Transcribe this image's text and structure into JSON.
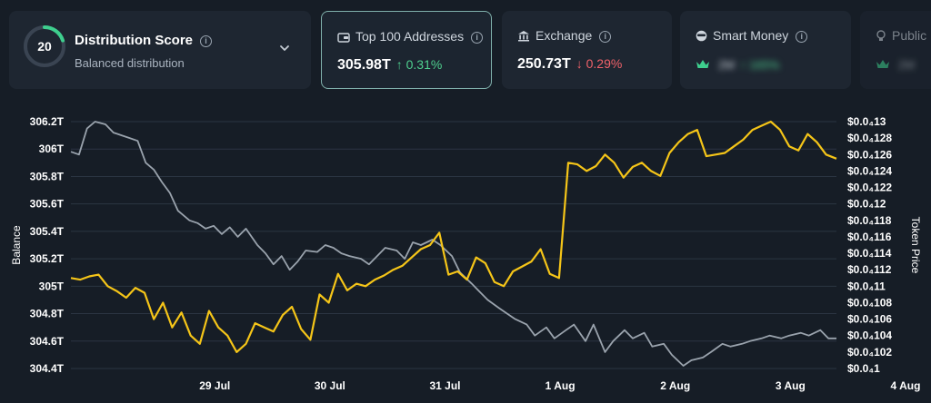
{
  "cards": {
    "distribution": {
      "score": "20",
      "title": "Distribution Score",
      "subtitle": "Balanced distribution",
      "info": "i",
      "gauge_fraction": 0.2,
      "gauge_color": "#3ecf8e"
    },
    "top100": {
      "label": "Top 100 Addresses",
      "value": "305.98T",
      "change": "↑ 0.31%",
      "info": "i"
    },
    "exchange": {
      "label": "Exchange",
      "value": "250.73T",
      "change": "↓ 0.29%",
      "info": "i"
    },
    "smart_money": {
      "label": "Smart Money",
      "value": "2M",
      "change": "↑ 165%",
      "info": "i"
    },
    "public": {
      "label": "Public",
      "value": "2M"
    }
  },
  "colors": {
    "balance_line": "#9aa3ad",
    "price_line": "#f5c518",
    "grid": "#2b3542",
    "positive": "#4fd08f",
    "negative": "#f0626a",
    "crown": "#3ecf8e"
  },
  "chart_data": {
    "type": "line",
    "ylabel": "Balance",
    "y2label": "Token Price",
    "x_ticks": [
      "29 Jul",
      "30 Jul",
      "31 Jul",
      "1 Aug",
      "2 Aug",
      "3 Aug",
      "4 Aug"
    ],
    "x_range": [
      27.75,
      34.4
    ],
    "ylim": [
      304.4,
      306.2
    ],
    "y_ticks": [
      "304.4T",
      "304.6T",
      "304.8T",
      "305T",
      "305.2T",
      "305.4T",
      "305.6T",
      "305.8T",
      "306T",
      "306.2T"
    ],
    "y2lim": [
      0.0001,
      0.00013
    ],
    "y2_ticks": [
      "$0.0₄1",
      "$0.0₄102",
      "$0.0₄104",
      "$0.0₄106",
      "$0.0₄108",
      "$0.0₄11",
      "$0.0₄112",
      "$0.0₄114",
      "$0.0₄116",
      "$0.0₄118",
      "$0.0₄12",
      "$0.0₄122",
      "$0.0₄124",
      "$0.0₄126",
      "$0.0₄128",
      "$0.0₄13"
    ],
    "grid": true,
    "series": [
      {
        "name": "Balance",
        "axis": "left",
        "x": [
          27.75,
          27.82,
          27.89,
          27.96,
          28.05,
          28.12,
          28.19,
          28.26,
          28.33,
          28.4,
          28.47,
          28.54,
          28.61,
          28.68,
          28.78,
          28.85,
          28.92,
          28.99,
          29.06,
          29.13,
          29.2,
          29.27,
          29.37,
          29.44,
          29.51,
          29.58,
          29.65,
          29.72,
          29.79,
          29.89,
          29.96,
          30.03,
          30.1,
          30.17,
          30.27,
          30.34,
          30.41,
          30.48,
          30.58,
          30.65,
          30.72,
          30.79,
          30.89,
          30.96,
          31.06,
          31.13,
          31.23,
          31.3,
          31.37,
          31.47,
          31.54,
          31.61,
          31.71,
          31.78,
          31.88,
          31.95,
          32.05,
          32.12,
          32.22,
          32.29,
          32.39,
          32.46,
          32.56,
          32.63,
          32.73,
          32.8,
          32.9,
          32.97,
          33.07,
          33.14,
          33.24,
          33.31,
          33.41,
          33.48,
          33.58,
          33.65,
          33.75,
          33.82,
          33.92,
          33.99,
          34.09,
          34.16,
          34.26,
          34.33,
          34.4
        ],
        "y": [
          305.98,
          305.96,
          306.15,
          306.2,
          306.18,
          306.12,
          306.1,
          306.08,
          306.06,
          305.9,
          305.85,
          305.76,
          305.68,
          305.55,
          305.48,
          305.46,
          305.42,
          305.44,
          305.38,
          305.43,
          305.36,
          305.42,
          305.3,
          305.24,
          305.16,
          305.22,
          305.12,
          305.18,
          305.26,
          305.25,
          305.3,
          305.28,
          305.24,
          305.22,
          305.2,
          305.16,
          305.22,
          305.28,
          305.26,
          305.2,
          305.32,
          305.3,
          305.34,
          305.3,
          305.22,
          305.1,
          305.02,
          304.96,
          304.9,
          304.84,
          304.8,
          304.76,
          304.72,
          304.64,
          304.7,
          304.62,
          304.68,
          304.72,
          304.6,
          304.72,
          304.52,
          304.6,
          304.68,
          304.62,
          304.66,
          304.56,
          304.58,
          304.5,
          304.42,
          304.46,
          304.48,
          304.52,
          304.58,
          304.56,
          304.58,
          304.6,
          304.62,
          304.64,
          304.62,
          304.64,
          304.66,
          304.64,
          304.68,
          304.62,
          304.62
        ]
      },
      {
        "name": "Token Price",
        "axis": "right",
        "x": [
          27.75,
          27.83,
          27.91,
          27.99,
          28.07,
          28.15,
          28.23,
          28.31,
          28.39,
          28.47,
          28.55,
          28.63,
          28.71,
          28.79,
          28.87,
          28.95,
          29.03,
          29.11,
          29.19,
          29.27,
          29.35,
          29.43,
          29.51,
          29.59,
          29.67,
          29.75,
          29.83,
          29.91,
          29.99,
          30.07,
          30.15,
          30.23,
          30.31,
          30.39,
          30.47,
          30.55,
          30.63,
          30.71,
          30.79,
          30.87,
          30.95,
          31.03,
          31.11,
          31.19,
          31.27,
          31.35,
          31.43,
          31.51,
          31.59,
          31.67,
          31.75,
          31.83,
          31.91,
          31.99,
          32.07,
          32.15,
          32.23,
          32.31,
          32.39,
          32.47,
          32.55,
          32.63,
          32.71,
          32.79,
          32.87,
          32.95,
          33.03,
          33.11,
          33.19,
          33.27,
          33.35,
          33.43,
          33.51,
          33.59,
          33.67,
          33.75,
          33.83,
          33.91,
          33.99,
          34.07,
          34.15,
          34.23,
          34.31,
          34.4
        ],
        "y": [
          0.000111,
          0.0001108,
          0.0001112,
          0.0001114,
          0.00011,
          0.0001094,
          0.0001086,
          0.0001098,
          0.0001092,
          0.000106,
          0.000108,
          0.000105,
          0.0001068,
          0.000104,
          0.000103,
          0.000107,
          0.000105,
          0.000104,
          0.000102,
          0.000103,
          0.0001055,
          0.000105,
          0.0001045,
          0.0001065,
          0.0001075,
          0.0001048,
          0.0001035,
          0.000109,
          0.000108,
          0.0001115,
          0.0001095,
          0.0001103,
          0.00011,
          0.0001108,
          0.0001113,
          0.000112,
          0.0001125,
          0.0001135,
          0.0001145,
          0.000115,
          0.0001165,
          0.0001114,
          0.0001118,
          0.0001108,
          0.0001135,
          0.0001128,
          0.0001105,
          0.00011,
          0.0001118,
          0.0001124,
          0.000113,
          0.0001145,
          0.0001115,
          0.000111,
          0.000125,
          0.0001248,
          0.000124,
          0.0001246,
          0.000126,
          0.000125,
          0.0001232,
          0.0001245,
          0.000125,
          0.000124,
          0.0001234,
          0.0001262,
          0.0001275,
          0.0001285,
          0.000129,
          0.0001258,
          0.000126,
          0.0001262,
          0.000127,
          0.0001278,
          0.000129,
          0.0001295,
          0.00013,
          0.000129,
          0.000127,
          0.0001265,
          0.0001285,
          0.0001275,
          0.000126,
          0.0001255
        ]
      }
    ]
  }
}
